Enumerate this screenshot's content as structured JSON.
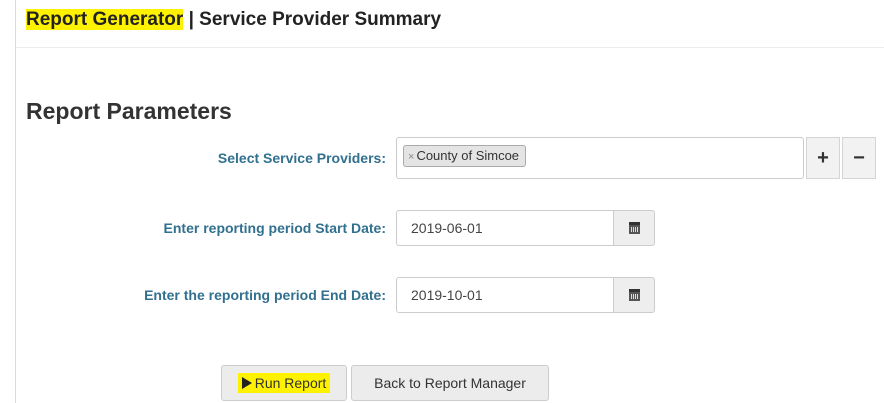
{
  "header": {
    "title_highlight": "Report Generator",
    "title_rest": " | Service Provider Summary"
  },
  "section": {
    "title": "Report Parameters"
  },
  "form": {
    "providers_label": "Select Service Providers:",
    "selected_providers": [
      {
        "label": "County of Simcoe",
        "remove_symbol": "×"
      }
    ],
    "add_label": "+",
    "remove_label": "−",
    "start_label": "Enter reporting period Start Date:",
    "start_value": "2019-06-01",
    "end_label": "Enter the reporting period End Date:",
    "end_value": "2019-10-01"
  },
  "actions": {
    "run_label": "Run Report",
    "back_label": "Back to Report Manager"
  },
  "colors": {
    "highlight": "#fff200",
    "label": "#31708f"
  },
  "icons": {
    "run": "play-icon",
    "calendar": "calendar-icon"
  }
}
